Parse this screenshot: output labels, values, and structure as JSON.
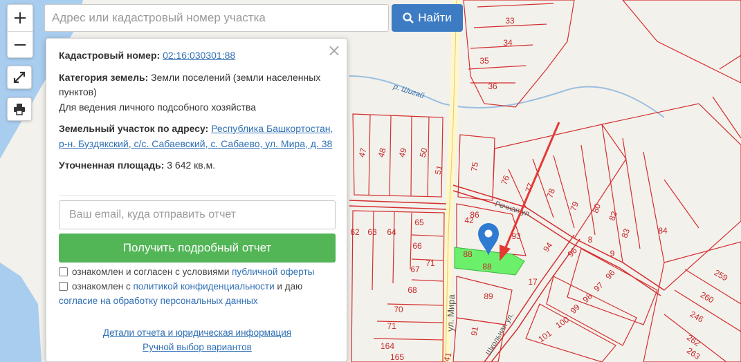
{
  "search": {
    "placeholder": "Адрес или кадастровый номер участка",
    "button_label": "Найти"
  },
  "controls": {
    "zoom_in": "+",
    "zoom_out": "−"
  },
  "popup": {
    "close": "×",
    "cadastral_label": "Кадастровый номер:",
    "cadastral_value": "02:16:030301:88",
    "category_label": "Категория земель:",
    "category_value": "Земли поселений (земли населенных пунктов)",
    "usage": "Для ведения личного подсобного хозяйства",
    "address_label": "Земельный участок по адресу:",
    "address_value": "Республика Башкортостан, р-н. Буздякский, с/с. Сабаевский, с. Сабаево, ул. Мира, д. 38",
    "area_label": "Уточненная площадь:",
    "area_value": "3 642 кв.м.",
    "email_placeholder": "Ваш email, куда отправить отчет",
    "submit_label": "Получить подробный отчет",
    "consent1_text": "ознакомлен и согласен с условиями",
    "consent1_link": "публичной оферты",
    "consent2_text": "ознакомлен с",
    "consent2_link": "политикой конфиденциальности",
    "consent2_mid": "и даю",
    "consent2_link2": "согласие на обработку персональных данных",
    "details_link": "Детали отчета и юридическая информация",
    "manual_link": "Ручной выбор вариантов"
  },
  "map": {
    "river_label": "р. Шигай",
    "street_label": "ул. Мира",
    "street2_label": "Речная ул.",
    "street3_label": "Школьная ул.",
    "highlight_color": "#6cf06c",
    "boundary_color": "#d32f2f",
    "water_color": "#a8cdef",
    "parcels": [
      "33",
      "34",
      "35",
      "36",
      "47",
      "48",
      "49",
      "50",
      "51",
      "75",
      "76",
      "77",
      "78",
      "79",
      "80",
      "82",
      "83",
      "84",
      "86",
      "42",
      "93",
      "94",
      "96",
      "8",
      "9",
      "96",
      "97",
      "98",
      "99",
      "100",
      "101",
      "89",
      "91",
      "62",
      "63",
      "64",
      "65",
      "66",
      "67",
      "71",
      "68",
      "70",
      "71",
      "164",
      "165",
      "341",
      "88",
      "88",
      "259",
      "260",
      "246",
      "262",
      "263",
      "17"
    ]
  }
}
